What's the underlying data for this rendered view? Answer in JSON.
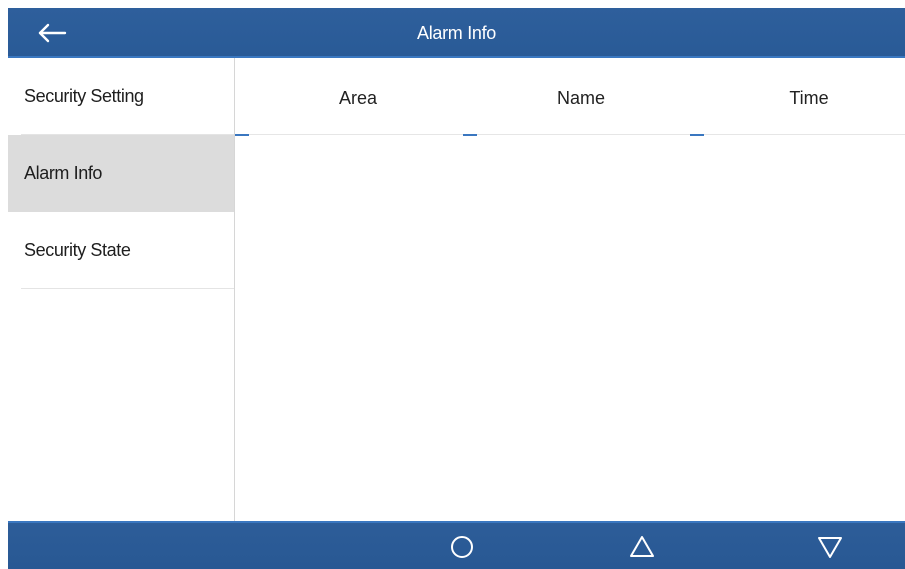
{
  "header": {
    "title": "Alarm Info",
    "back_icon": "arrow-left-icon",
    "background": "#2b5c98"
  },
  "sidebar": {
    "items": [
      {
        "label": "Security Setting",
        "active": false
      },
      {
        "label": "Alarm Info",
        "active": true
      },
      {
        "label": "Security State",
        "active": false
      }
    ],
    "active_background": "#dcdcdc"
  },
  "table": {
    "columns": [
      "Area",
      "Name",
      "Time"
    ],
    "rows": []
  },
  "navbar": {
    "buttons": [
      {
        "icon": "circle-home-icon"
      },
      {
        "icon": "triangle-up-icon"
      },
      {
        "icon": "triangle-down-icon"
      }
    ],
    "background": "#2b5c98"
  }
}
